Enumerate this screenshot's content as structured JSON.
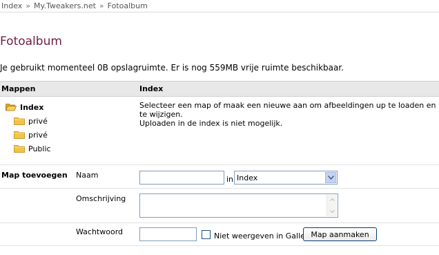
{
  "breadcrumb": {
    "items": [
      "Index",
      "My.Tweakers.net",
      "Fotoalbum"
    ],
    "separator": "»"
  },
  "page": {
    "title": "Fotoalbum",
    "usage_text": "Je gebruikt momenteel 0B opslagruimte. Er is nog 559MB vrije ruimte beschikbaar."
  },
  "table": {
    "col_folders": "Mappen",
    "col_index": "Index"
  },
  "folders": {
    "root": "Index",
    "children": [
      "privé",
      "privé",
      "Public"
    ]
  },
  "info": {
    "line1": "Selecteer een map of maak een nieuwe aan om afbeeldingen up te loaden en te wijzigen.",
    "line2": "Uploaden in de index is niet mogelijk."
  },
  "form": {
    "section_label": "Map toevoegen",
    "name_label": "Naam",
    "name_value": "",
    "in_label": "in",
    "parent_select_value": "Index",
    "description_label": "Omschrijving",
    "description_value": "",
    "password_label": "Wachtwoord",
    "password_value": "",
    "hide_in_gallery_label": "Niet weergeven in Gallery",
    "hide_in_gallery_checked": false,
    "submit_label": "Map aanmaken"
  },
  "icons": {
    "folder_open": "folder-open-icon",
    "folder": "folder-icon",
    "dropdown_arrow": "chevron-down-icon",
    "scroll_up": "scroll-up-icon",
    "scroll_down": "scroll-down-icon"
  },
  "colors": {
    "title": "#6d1f3f",
    "header_bg": "#e8e8e8",
    "folder": "#f5c242"
  }
}
